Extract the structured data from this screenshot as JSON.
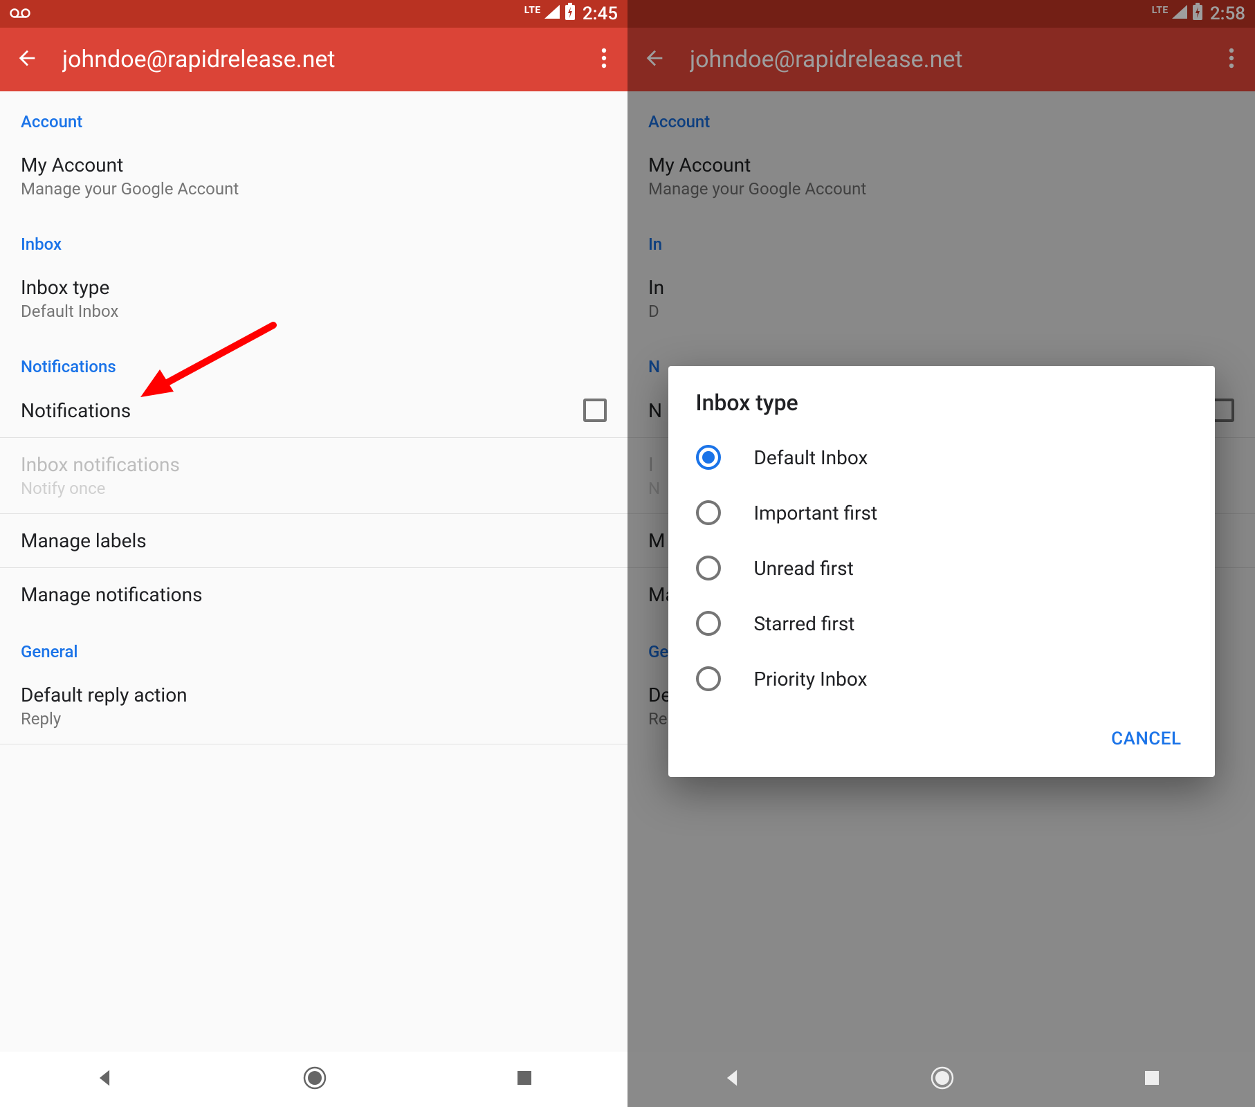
{
  "left": {
    "status": {
      "time": "2:45",
      "lte": "LTE"
    },
    "appbar": {
      "title": "johndoe@rapidrelease.net"
    },
    "sections": {
      "account": {
        "header": "Account",
        "my_account": {
          "title": "My Account",
          "sub": "Manage your Google Account"
        }
      },
      "inbox": {
        "header": "Inbox",
        "inbox_type": {
          "title": "Inbox type",
          "sub": "Default Inbox"
        }
      },
      "notifications": {
        "header": "Notifications",
        "notifications": {
          "title": "Notifications"
        },
        "inbox_notifications": {
          "title": "Inbox notifications",
          "sub": "Notify once"
        },
        "manage_labels": {
          "title": "Manage labels"
        },
        "manage_notifications": {
          "title": "Manage notifications"
        }
      },
      "general": {
        "header": "General",
        "default_reply": {
          "title": "Default reply action",
          "sub": "Reply"
        }
      }
    }
  },
  "right": {
    "status": {
      "time": "2:58",
      "lte": "LTE"
    },
    "appbar": {
      "title": "johndoe@rapidrelease.net"
    },
    "sections": {
      "account": {
        "header": "Account",
        "my_account": {
          "title": "My Account",
          "sub": "Manage your Google Account"
        }
      },
      "inbox": {
        "header": "In",
        "inbox_type": {
          "title": "In",
          "sub": "D"
        }
      },
      "notifications": {
        "header": "N",
        "notifications": {
          "title": "N"
        },
        "inbox_notifications": {
          "title": "I",
          "sub": "N"
        },
        "manage_labels": {
          "title": "M"
        },
        "manage_notifications": {
          "title": "Manage notifications"
        }
      },
      "general": {
        "header": "General",
        "default_reply": {
          "title": "Default reply action",
          "sub": "Reply"
        }
      }
    },
    "dialog": {
      "title": "Inbox type",
      "options": [
        {
          "label": "Default Inbox",
          "selected": true
        },
        {
          "label": "Important first",
          "selected": false
        },
        {
          "label": "Unread first",
          "selected": false
        },
        {
          "label": "Starred first",
          "selected": false
        },
        {
          "label": "Priority Inbox",
          "selected": false
        }
      ],
      "cancel": "CANCEL"
    }
  }
}
